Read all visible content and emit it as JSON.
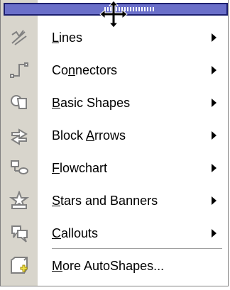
{
  "menu": {
    "items": [
      {
        "label": "Lines",
        "mnemonic_index": 0,
        "icon": "lines-icon",
        "has_submenu": true
      },
      {
        "label": "Connectors",
        "mnemonic_index": 2,
        "icon": "connectors-icon",
        "has_submenu": true
      },
      {
        "label": "Basic Shapes",
        "mnemonic_index": 0,
        "icon": "basic-shapes-icon",
        "has_submenu": true
      },
      {
        "label": "Block Arrows",
        "mnemonic_index": 6,
        "icon": "block-arrows-icon",
        "has_submenu": true
      },
      {
        "label": "Flowchart",
        "mnemonic_index": 0,
        "icon": "flowchart-icon",
        "has_submenu": true
      },
      {
        "label": "Stars and Banners",
        "mnemonic_index": 0,
        "icon": "stars-and-banners-icon",
        "has_submenu": true
      },
      {
        "label": "Callouts",
        "mnemonic_index": 0,
        "icon": "callouts-icon",
        "has_submenu": true
      },
      {
        "label": "More AutoShapes...",
        "mnemonic_index": 0,
        "icon": "more-autoshapes-icon",
        "has_submenu": false
      }
    ]
  },
  "colors": {
    "gutter": "#d8d5cc",
    "title_bar": "#6a6fc9",
    "title_bar_border": "#1c1f6e"
  }
}
